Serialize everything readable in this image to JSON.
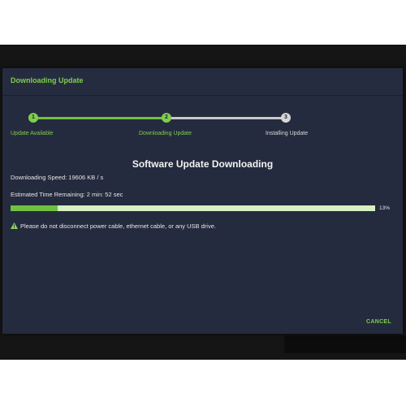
{
  "dialog": {
    "title": "Downloading Update"
  },
  "steps": [
    {
      "number": "1",
      "label": "Update Available",
      "state": "complete"
    },
    {
      "number": "2",
      "label": "Downloading Update",
      "state": "active"
    },
    {
      "number": "3",
      "label": "Installing Update",
      "state": "pending"
    }
  ],
  "content": {
    "heading": "Software Update Downloading",
    "speed_text": "Downloading Speed: 19606 KB / s",
    "eta_text": "Estimated Time Remaining: 2 min: 52 sec",
    "progress": {
      "percent_value": 13,
      "percent_label": "13%"
    },
    "warning_text": "Please do not disconnect power cable, ethernet cable, or any USB drive."
  },
  "actions": {
    "cancel_label": "CANCEL"
  },
  "colors": {
    "accent": "#7fce4c",
    "dialog_bg": "#252b3e",
    "progress_track": "#d7f0c4",
    "pending": "#d6d6d6"
  },
  "icons": {
    "warning": "warning-triangle-icon"
  }
}
